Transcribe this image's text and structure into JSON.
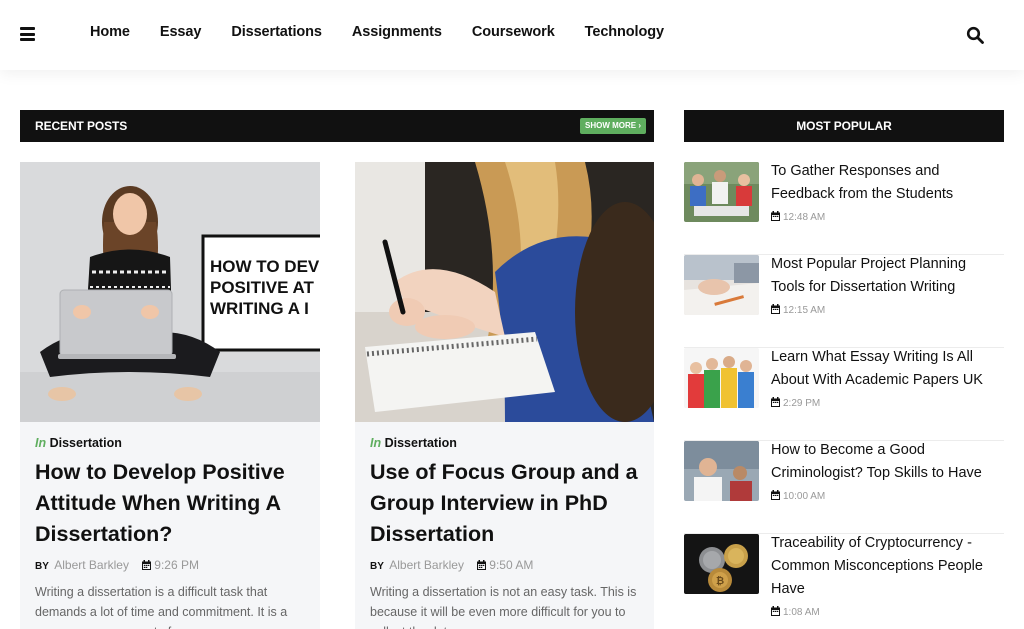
{
  "nav": {
    "items": [
      "Home",
      "Essay",
      "Dissertations",
      "Assignments",
      "Coursework",
      "Technology"
    ]
  },
  "recent": {
    "title": "RECENT POSTS",
    "show_more": "SHOW MORE ›",
    "posts": [
      {
        "category_prefix": "In",
        "category": "Dissertation",
        "title": "How to Develop Positive Attitude When Writing A Dissertation?",
        "by": "BY",
        "author": "Albert Barkley",
        "time": "9:26 PM",
        "excerpt": "Writing a dissertation is a difficult task that demands a lot of time and commitment. It is a necessary component of a",
        "image_text": "HOW TO DEVELOP POSITIVE ATTITUDE WRITING A DISSERTATION"
      },
      {
        "category_prefix": "In",
        "category": "Dissertation",
        "title": "Use of Focus Group and a Group Interview in PhD Dissertation",
        "by": "BY",
        "author": "Albert Barkley",
        "time": "9:50 AM",
        "excerpt": "Writing a dissertation is not an easy task. This is because it will be even more difficult for you to collect the data"
      }
    ]
  },
  "popular": {
    "title": "MOST POPULAR",
    "items": [
      {
        "title": "To Gather Responses and Feedback from the Students",
        "time": "12:48 AM"
      },
      {
        "title": "Most Popular Project Planning Tools for Dissertation Writing",
        "time": "12:15 AM"
      },
      {
        "title": "Learn What Essay Writing Is All About With Academic Papers UK",
        "time": "2:29 PM"
      },
      {
        "title": "How to Become a Good Criminologist? Top Skills to Have",
        "time": "10:00 AM"
      },
      {
        "title": "Traceability of Cryptocurrency - Common Misconceptions People Have",
        "time": "1:08 AM"
      }
    ]
  },
  "colors": {
    "accent_green": "#5fae5f",
    "bar_black": "#111111",
    "meta_gray": "#999999"
  }
}
